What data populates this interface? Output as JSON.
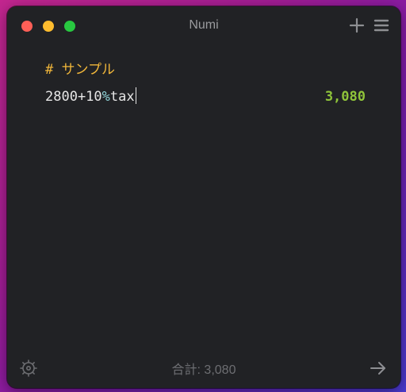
{
  "window": {
    "title": "Numi"
  },
  "toolbar": {
    "add_icon": "plus-icon",
    "menu_icon": "hamburger-menu-icon"
  },
  "editor": {
    "heading": "# サンプル",
    "expression": {
      "number": "2800+10",
      "percent": "%",
      "unit": "tax"
    },
    "result": "3,080"
  },
  "footer": {
    "total": "合計: 3,080",
    "settings_icon": "gear-icon",
    "share_icon": "arrow-right-icon"
  },
  "colors": {
    "window_bg": "#212225",
    "heading": "#f0b63a",
    "result": "#8fc43a",
    "percent": "#8fd1d6",
    "text": "#e6e6e6",
    "muted": "#6d6e72"
  }
}
